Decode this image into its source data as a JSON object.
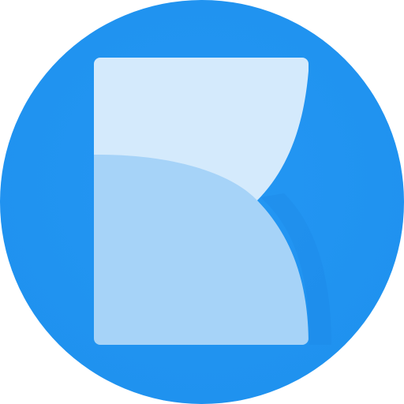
{
  "app_icon": {
    "icon_name": "app-logo-icon",
    "colors": {
      "circle_background": "#2196F3",
      "circle_shadow": "#1E88E5",
      "panel_top": "#D4EAFC",
      "panel_bottom": "#A6D3F8"
    }
  }
}
